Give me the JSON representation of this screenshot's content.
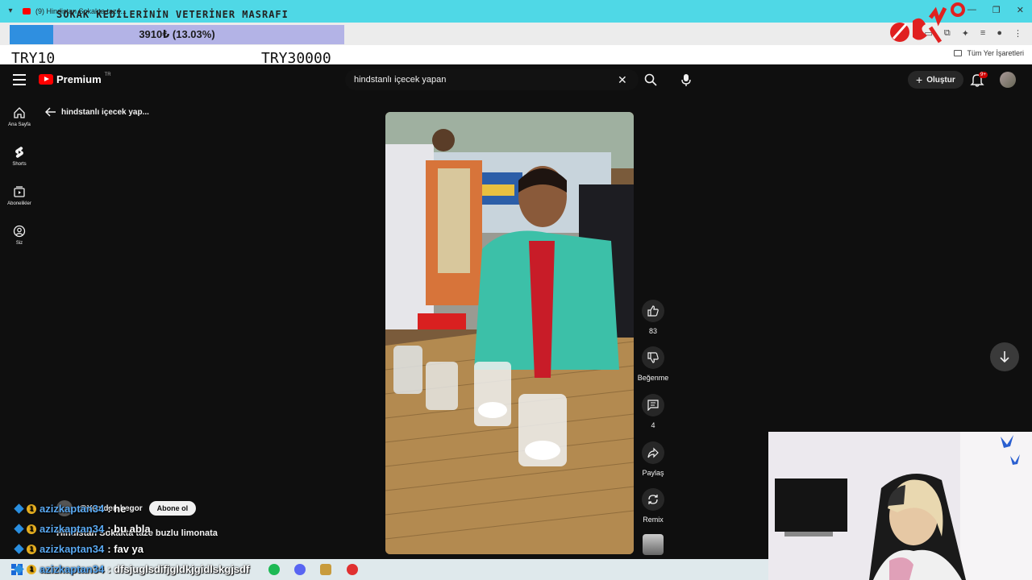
{
  "browser": {
    "tab_title": "(9) Hindistan Sokakta taze...",
    "bookmarks_all": "Tüm Yer İşaretleri"
  },
  "donation": {
    "title": "SOKAK KEDİLERİNİN VETERİNER MASRAFI",
    "progress_text": "3910₺ (13.03%)",
    "progress_fraction": 0.1303,
    "min_label": "TRY10",
    "max_label": "TRY30000"
  },
  "header": {
    "logo_text": "Premium",
    "logo_region": "TR",
    "search_value": "hindstanlı içecek yapan",
    "create_label": "Oluştur",
    "notification_count": "9+"
  },
  "sidebar": {
    "items": [
      {
        "label": "Ana Sayfa",
        "icon": "home-icon"
      },
      {
        "label": "Shorts",
        "icon": "shorts-icon"
      },
      {
        "label": "Abonelikler",
        "icon": "subscriptions-icon"
      },
      {
        "label": "Siz",
        "icon": "you-icon"
      }
    ]
  },
  "back": {
    "label": "hindstanlı içecek yap..."
  },
  "actions": {
    "like_count": "83",
    "dislike_label": "Beğenme",
    "comment_count": "4",
    "share_label": "Paylaş",
    "remix_label": "Remix"
  },
  "video": {
    "channel_name": "@Yeniden.begor",
    "subscribe_label": "Abone ol",
    "caption": "Hindistan Sokakta taze buzlu limonata"
  },
  "chat": [
    {
      "user": "azizkaptan34",
      "message": ": he"
    },
    {
      "user": "azizkaptan34",
      "message": ": bu abla"
    },
    {
      "user": "azizkaptan34",
      "message": ": fav ya"
    },
    {
      "user": "azizkaptan34",
      "message": ": dfsjuglsdifjgldkjgidlskgjsdf"
    }
  ],
  "colors": {
    "yt_red": "#ff0000",
    "chat_user": "#5aa8f0",
    "donation_fill": "#2f8fe0",
    "donation_track": "#b3b3e6",
    "tab_bar": "#4fd8e6"
  }
}
